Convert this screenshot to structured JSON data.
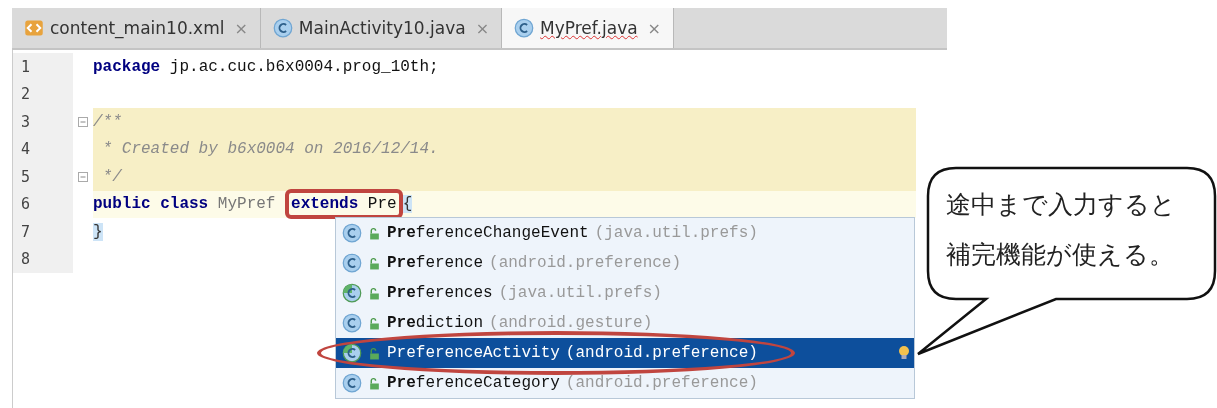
{
  "tabs": [
    {
      "kind": "xml",
      "label": "content_main10.xml",
      "close": "×",
      "selected": false
    },
    {
      "kind": "class",
      "label": "MainActivity10.java",
      "close": "×",
      "selected": false
    },
    {
      "kind": "class",
      "label": "MyPref.java",
      "close": "×",
      "selected": true
    }
  ],
  "code_lines": [
    {
      "number": "1",
      "kind": "code",
      "fold": false,
      "segments": [
        {
          "kind": "keyword",
          "text": "package",
          "boxed": false
        },
        {
          "kind": "plain",
          "text": " jp.ac.cuc.b6x0004.prog_10th;",
          "boxed": false
        }
      ]
    },
    {
      "number": "2",
      "kind": "code",
      "fold": false
    },
    {
      "number": "3",
      "kind": "comment",
      "fold": true,
      "segments": [
        {
          "kind": "comment",
          "text": "/**",
          "boxed": false
        }
      ]
    },
    {
      "number": "4",
      "kind": "comment",
      "fold": false,
      "segments": [
        {
          "kind": "comment",
          "text": " * Created by b6x0004 on 2016/12/14.",
          "boxed": false
        }
      ]
    },
    {
      "number": "5",
      "kind": "comment",
      "fold": true,
      "segments": [
        {
          "kind": "comment",
          "text": " */",
          "boxed": false
        }
      ]
    },
    {
      "number": "6",
      "kind": "caret",
      "fold": false,
      "segments": [
        {
          "kind": "keyword",
          "text": "public class",
          "boxed": false
        },
        {
          "kind": "unused",
          "text": " MyPref ",
          "boxed": false
        },
        {
          "kind": "keyword",
          "text": "extends",
          "boxed": true
        },
        {
          "kind": "plain",
          "text": " Pre",
          "boxed": true
        },
        {
          "kind": "brace",
          "text": "{",
          "boxed": false
        }
      ]
    },
    {
      "number": "7",
      "kind": "code",
      "fold": false,
      "segments": [
        {
          "kind": "brace",
          "text": "}",
          "boxed": false
        }
      ]
    },
    {
      "number": "8",
      "kind": "code",
      "fold": false
    }
  ],
  "completion": [
    {
      "kind": "class",
      "name": "**Pre**ferenceChangeEvent",
      "package": "(java.util.prefs)",
      "selected": false,
      "circled": false
    },
    {
      "kind": "class",
      "name": "**Pre**ference",
      "package": "(android.preference)",
      "selected": false,
      "circled": false
    },
    {
      "kind": "abstract",
      "name": "**Pre**ferences",
      "package": "(java.util.prefs)",
      "selected": false,
      "circled": false
    },
    {
      "kind": "class",
      "name": "**Pre**diction",
      "package": "(android.gesture)",
      "selected": false,
      "circled": false
    },
    {
      "kind": "abstract",
      "name": "PreferenceActivity",
      "package": "(android.preference)",
      "selected": true,
      "circled": true
    },
    {
      "kind": "class",
      "name": "**Pre**ferenceCategory",
      "package": "(android.preference)",
      "selected": false,
      "circled": false
    }
  ],
  "callout": {
    "text": "途中まで入力すると補完機能が使える。"
  }
}
